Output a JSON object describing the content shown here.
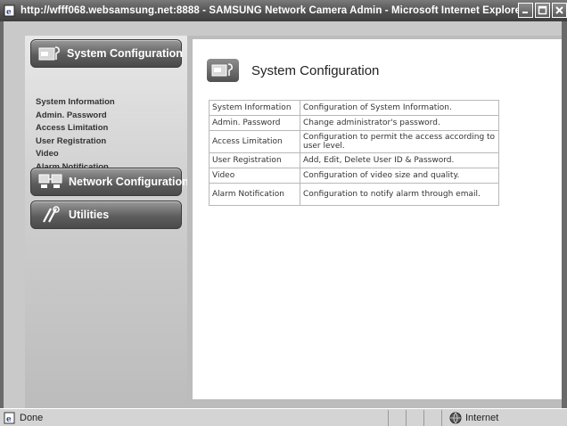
{
  "window": {
    "title": "http://wfff068.websamsung.net:8888 - SAMSUNG Network Camera Admin - Microsoft Internet Explorer"
  },
  "sidebar": {
    "system_configuration": "System Configuration",
    "items": [
      {
        "label": "System Information"
      },
      {
        "label": "Admin. Password"
      },
      {
        "label": "Access Limitation"
      },
      {
        "label": "User Registration"
      },
      {
        "label": "Video"
      },
      {
        "label": "Alarm Notification"
      }
    ],
    "network_configuration": "Network Configuration",
    "utilities": "Utilities"
  },
  "content": {
    "title": "System Configuration",
    "rows": [
      {
        "name": "System Information",
        "desc": "Configuration of System Information."
      },
      {
        "name": "Admin. Password",
        "desc": "Change administrator's password."
      },
      {
        "name": "Access Limitation",
        "desc": "Configuration to permit the access according to user level."
      },
      {
        "name": "User Registration",
        "desc": "Add, Edit, Delete User ID & Password."
      },
      {
        "name": "Video",
        "desc": "Configuration of video size and quality."
      },
      {
        "name": "Alarm Notification",
        "desc": "Configuration to notify alarm through email."
      }
    ]
  },
  "statusbar": {
    "left": "Done",
    "zone": "Internet"
  }
}
